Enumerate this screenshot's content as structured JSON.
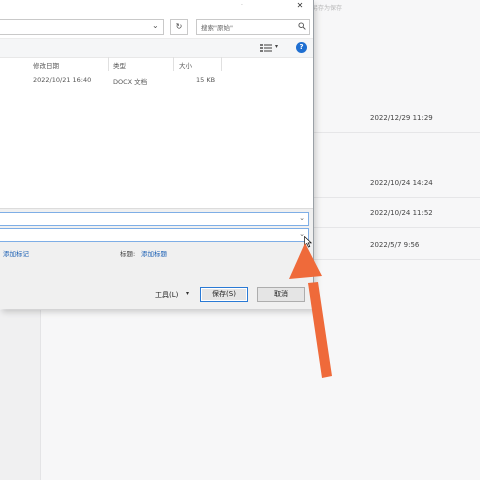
{
  "background": {
    "corner_text": "另存为保存",
    "recent_dates": [
      "2022/12/29 11:29",
      "2022/10/24 14:24",
      "2022/10/24 11:52",
      "2022/5/7 9:56"
    ]
  },
  "dialog": {
    "title_dot": "·",
    "close_glyph": "✕",
    "refresh_glyph": "↻",
    "search_placeholder": "搜索\"原始\"",
    "address_chevron": "⌄",
    "view_dropdown_glyph": "▾",
    "help_glyph": "?",
    "columns": [
      "修改日期",
      "类型",
      "大小"
    ],
    "file": {
      "modified": "2022/10/21 16:40",
      "type": "DOCX 文档",
      "size": "15 KB"
    },
    "fields": {
      "filename_chevron": "⌄",
      "filetype_chevron": "⌄"
    },
    "tags_link": "添加标记",
    "title_label": "标题:",
    "title_link": "添加标题",
    "tools_label": "工具(L)",
    "tools_dropdown_glyph": "▾",
    "save_button": "保存(S)",
    "cancel_button": "取消"
  },
  "colors": {
    "arrow": "#ef6a3a",
    "link": "#1a5fb4",
    "help_icon": "#1f6fd1",
    "primary_border": "#2a7ad5"
  }
}
